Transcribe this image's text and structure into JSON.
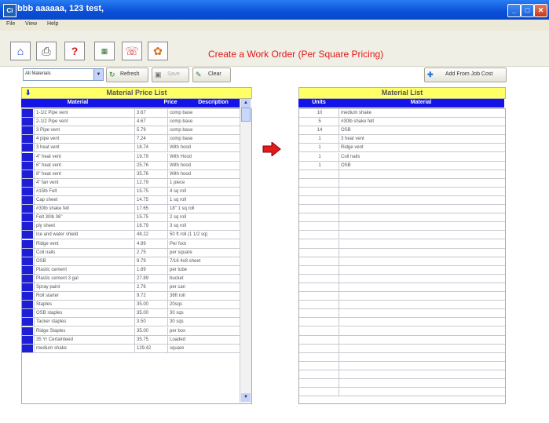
{
  "window": {
    "title": "bbb aaaaaa, 123 test,",
    "app_icon_text": "Ci"
  },
  "menu": [
    "File",
    "View",
    "Help"
  ],
  "toolbar": {
    "icons": [
      "home-icon",
      "print-icon",
      "help-icon",
      "calculator-icon",
      "phone-icon",
      "palette-icon"
    ],
    "screen_title": "Create a Work Order  (Per Square Pricing)"
  },
  "controls": {
    "filter_value": "All Materials",
    "refresh_label": "Refresh",
    "save_label": "Save",
    "clear_label": "Clear",
    "add_job_cost_label": "Add From Job Cost"
  },
  "price_list": {
    "title": "Material Price List",
    "columns": [
      "Material",
      "Price",
      "Description"
    ],
    "rows": [
      [
        "1-1/2 Pipe vent",
        "3.67",
        "comp base"
      ],
      [
        "2-1/2 Pipe vent",
        "4.67",
        "comp base"
      ],
      [
        "3 Pipe vent",
        "5.79",
        "comp base"
      ],
      [
        "4 pipe vent",
        "7.24",
        "comp base"
      ],
      [
        "3 heat vent",
        "18.74",
        "With hood"
      ],
      [
        "4\" heat vent",
        "19.79",
        "With Hood"
      ],
      [
        "6\" heat vent",
        "25.76",
        "With hood"
      ],
      [
        "8\" heat vent",
        "35.76",
        "With hood"
      ],
      [
        "4\" fan vent",
        "12.79",
        "1 piece"
      ],
      [
        "#15lb Felt",
        "15.75",
        "4 sq roll"
      ],
      [
        "Cap sheet",
        "14.75",
        "1 sq roll"
      ],
      [
        "#30lb shake felt",
        "17.65",
        "18\" 1 sq roll"
      ],
      [
        "Felt 30lb 36\"",
        "15.75",
        "2 sq roll"
      ],
      [
        "ply sheet",
        "18.79",
        "3 sq roll"
      ],
      [
        "Ice and water shield",
        "48.22",
        "50 ft roll (1 1/2 sq)"
      ],
      [
        "Ridge vent",
        "4.99",
        "Per foot"
      ],
      [
        "Coil nails",
        "2.75",
        "per square"
      ],
      [
        "OSB",
        "9.79",
        "7/16 4x8 sheet"
      ],
      [
        "Plastic cement",
        "1.89",
        "per tube"
      ],
      [
        "Plastic cement 3 gal",
        "27.89",
        "bucket"
      ],
      [
        "Spray paint",
        "2.76",
        "per can"
      ],
      [
        "Roll starter",
        "9.72",
        "36ft roll"
      ],
      [
        "Staples",
        "35.00",
        "20sqs"
      ],
      [
        "OSB staples",
        "35.00",
        "30 sqs"
      ],
      [
        "Tacker staples",
        "3.50",
        "30 sqs"
      ],
      [
        "Ridge Staples",
        "35.00",
        "per box"
      ],
      [
        "35 Yr Certainteed",
        "35.75",
        "Loaded"
      ],
      [
        "medium shake",
        "129.42",
        "square"
      ]
    ]
  },
  "material_list": {
    "title": "Material List",
    "columns": [
      "Units",
      "Material"
    ],
    "rows": [
      [
        "10",
        "medium shake"
      ],
      [
        "5",
        "#30lb shake felt"
      ],
      [
        "14",
        "OSB"
      ],
      [
        "1",
        "3 heat vent"
      ],
      [
        "1",
        "Ridge vent"
      ],
      [
        "1",
        "Coil nails"
      ],
      [
        "1",
        "OSB"
      ]
    ],
    "empty_rows": 26
  },
  "colors": {
    "header_blue": "#1414e6",
    "title_yellow": "#ffff66",
    "screen_title_red": "#e01818"
  }
}
